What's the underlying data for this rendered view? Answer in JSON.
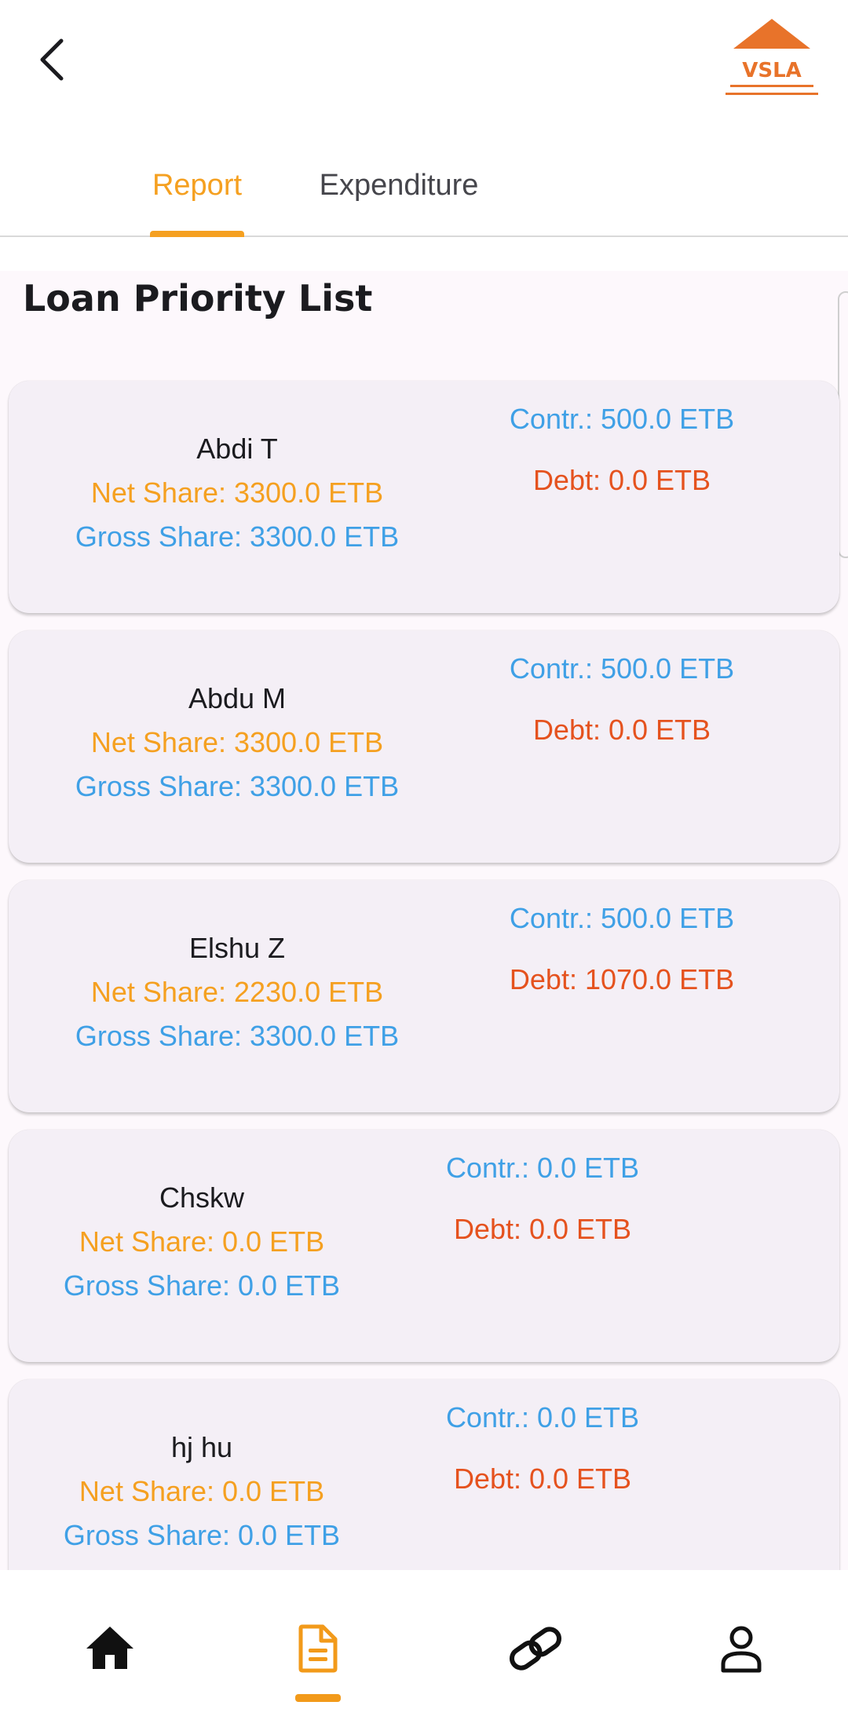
{
  "header": {
    "back_icon": "chevron-left-icon",
    "logo_text": "VSLA",
    "brand_color": "#e8732a"
  },
  "tabs": [
    {
      "label": "Report",
      "active": true
    },
    {
      "label": "Expenditure",
      "active": false
    }
  ],
  "section_title": "Loan Priority List",
  "members": [
    {
      "name": "Abdi T",
      "net_share": "Net Share: 3300.0 ETB",
      "gross_share": "Gross Share: 3300.0 ETB",
      "contribution": "Contr.: 500.0 ETB",
      "debt": "Debt: 0.0 ETB"
    },
    {
      "name": "Abdu M",
      "net_share": "Net Share: 3300.0 ETB",
      "gross_share": "Gross Share: 3300.0 ETB",
      "contribution": "Contr.: 500.0 ETB",
      "debt": "Debt: 0.0 ETB"
    },
    {
      "name": "Elshu Z",
      "net_share": "Net Share: 2230.0 ETB",
      "gross_share": "Gross Share: 3300.0 ETB",
      "contribution": "Contr.: 500.0 ETB",
      "debt": "Debt: 1070.0 ETB"
    },
    {
      "name": "Chskw",
      "net_share": "Net Share: 0.0 ETB",
      "gross_share": "Gross Share: 0.0 ETB",
      "contribution": "Contr.: 0.0 ETB",
      "debt": "Debt: 0.0 ETB"
    },
    {
      "name": "hj hu",
      "net_share": "Net Share: 0.0 ETB",
      "gross_share": "Gross Share: 0.0 ETB",
      "contribution": "Contr.: 0.0 ETB",
      "debt": "Debt: 0.0 ETB"
    }
  ],
  "colors": {
    "accent": "#f5a020",
    "net_share": "#f5a020",
    "gross_share": "#3fa0e6",
    "contribution": "#3fa0e6",
    "debt": "#e5521e"
  },
  "bottom_nav": [
    {
      "icon": "home-icon",
      "active": false
    },
    {
      "icon": "document-icon",
      "active": true
    },
    {
      "icon": "link-icon",
      "active": false
    },
    {
      "icon": "person-icon",
      "active": false
    }
  ]
}
